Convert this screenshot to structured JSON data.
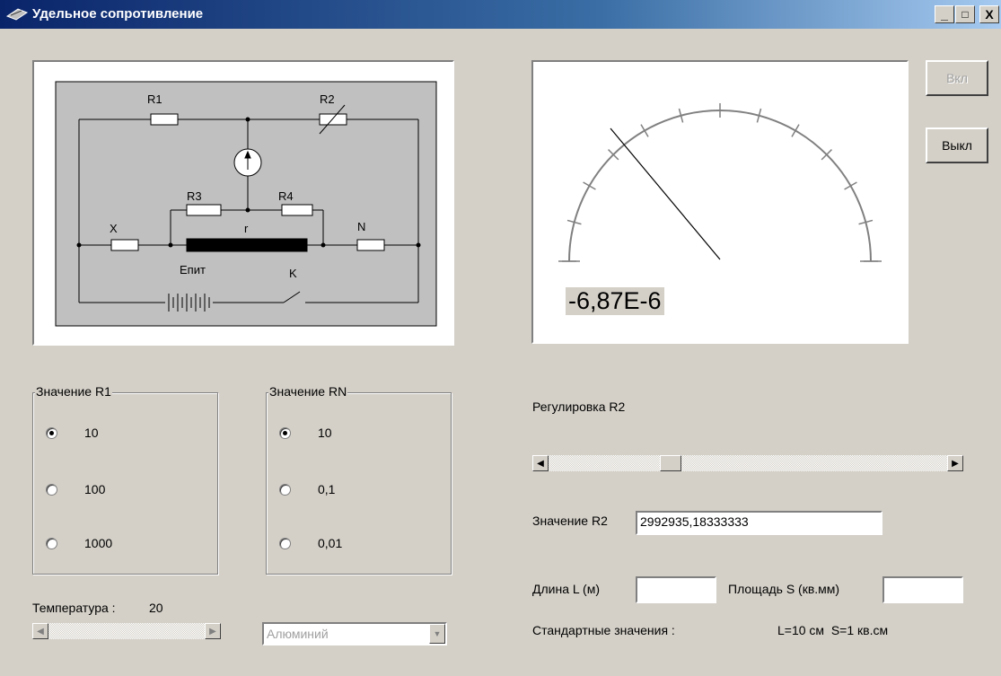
{
  "window": {
    "title": "Удельное сопротивление",
    "minimize": "_",
    "maximize": "□",
    "close": "X"
  },
  "circuit": {
    "labels": {
      "r1": "R1",
      "r2": "R2",
      "r3": "R3",
      "r4": "R4",
      "x": "X",
      "n": "N",
      "r": "r",
      "supply": "Епит",
      "key": "K"
    }
  },
  "meter": {
    "value_text": "-6,87E-6"
  },
  "buttons": {
    "on_label": "Вкл",
    "off_label": "Выкл"
  },
  "group_r1": {
    "title": "Значение R1",
    "options": [
      "10",
      "100",
      "1000"
    ],
    "selected": "10"
  },
  "group_rn": {
    "title": "Значение RN",
    "options": [
      "10",
      "0,1",
      "0,01"
    ],
    "selected": "10"
  },
  "temperature": {
    "label": "Температура :",
    "value": "20"
  },
  "material_select": {
    "value": "Алюминий"
  },
  "r2_adjust": {
    "label": "Регулировка R2"
  },
  "r2_value": {
    "label": "Значение R2",
    "value": "2992935,18333333"
  },
  "length": {
    "label": "Длина L (м)",
    "value": ""
  },
  "area": {
    "label": "Площадь S (кв.мм)",
    "value": ""
  },
  "standard": {
    "label": "Стандартные значения :",
    "value": "L=10 см  S=1 кв.см"
  }
}
